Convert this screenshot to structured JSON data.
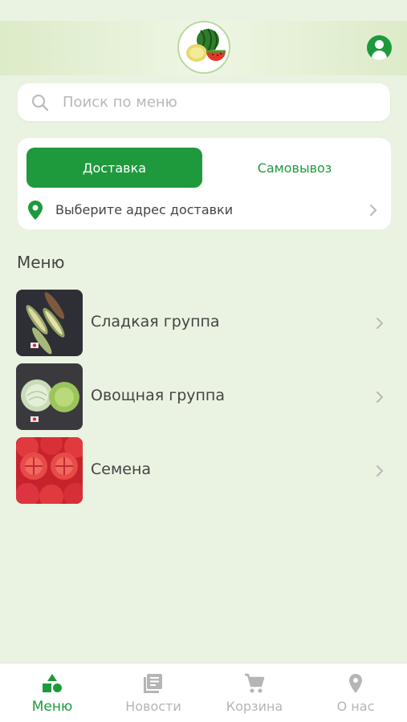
{
  "colors": {
    "accent": "#1e9a3c",
    "background": "#eaf3e1",
    "inactive": "#b5b5b5"
  },
  "header": {
    "logo_icon": "watermelon-melon-logo",
    "profile_icon": "user-icon"
  },
  "search": {
    "placeholder": "Поиск по меню",
    "value": ""
  },
  "delivery": {
    "tabs": [
      {
        "label": "Доставка",
        "active": true
      },
      {
        "label": "Самовывоз",
        "active": false
      }
    ],
    "address_label": "Выберите адрес доставки"
  },
  "menu": {
    "title": "Меню",
    "categories": [
      {
        "label": "Сладкая группа",
        "thumb": "corn-photo"
      },
      {
        "label": "Овощная группа",
        "thumb": "cabbage-photo"
      },
      {
        "label": "Семена",
        "thumb": "tomato-photo"
      }
    ]
  },
  "bottom_nav": [
    {
      "label": "Меню",
      "icon": "shapes-icon",
      "active": true
    },
    {
      "label": "Новости",
      "icon": "news-icon",
      "active": false
    },
    {
      "label": "Корзина",
      "icon": "cart-icon",
      "active": false
    },
    {
      "label": "О нас",
      "icon": "location-icon",
      "active": false
    }
  ]
}
